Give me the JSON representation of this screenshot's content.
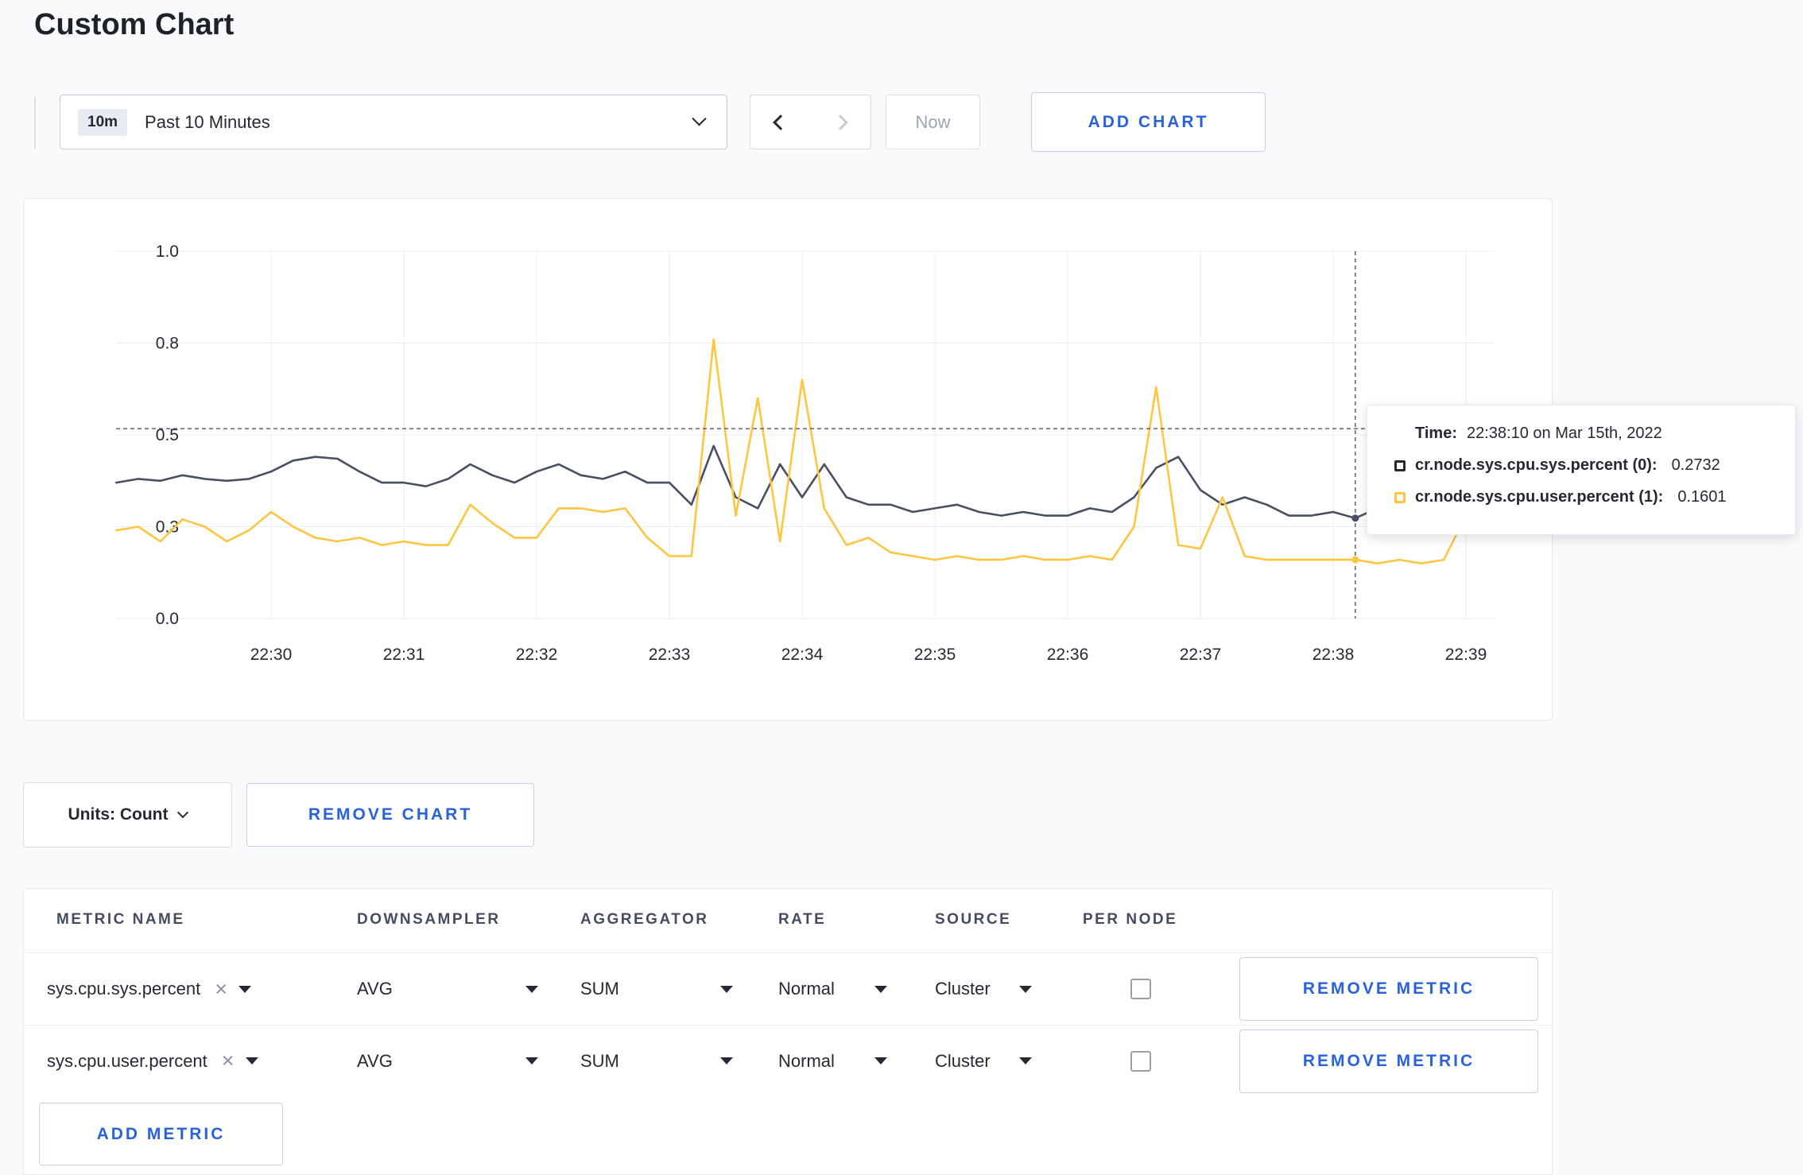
{
  "page": {
    "title": "Custom Chart"
  },
  "colors": {
    "accent": "#2962d9",
    "text_dark": "#242933",
    "muted": "#9ba3b4"
  },
  "toolbar": {
    "time_badge": "10m",
    "time_label": "Past 10 Minutes",
    "now_label": "Now",
    "add_chart_label": "ADD CHART"
  },
  "chart_data": {
    "type": "line",
    "title": "",
    "ylim": [
      0,
      1
    ],
    "y_ticks": [
      0,
      0.25,
      0.5,
      0.75,
      1
    ],
    "y_tick_labels": [
      "0.0",
      "0.3",
      "0.5",
      "0.8",
      "1.0"
    ],
    "x_tick_minutes": [
      30,
      31,
      32,
      33,
      34,
      35,
      36,
      37,
      38,
      39
    ],
    "x_ticks": [
      "22:30",
      "22:31",
      "22:32",
      "22:33",
      "22:34",
      "22:35",
      "22:36",
      "22:37",
      "22:38",
      "22:39"
    ],
    "t_start": 28.8333,
    "t_step": 0.166667,
    "grid_color": "#e9ecf2",
    "legend_position": "tooltip",
    "series": [
      {
        "name": "cr.node.sys.cpu.sys.percent",
        "color": "#475063",
        "values": [
          0.37,
          0.38,
          0.375,
          0.39,
          0.38,
          0.375,
          0.38,
          0.4,
          0.43,
          0.44,
          0.435,
          0.4,
          0.37,
          0.37,
          0.36,
          0.38,
          0.42,
          0.39,
          0.37,
          0.4,
          0.42,
          0.39,
          0.38,
          0.4,
          0.37,
          0.37,
          0.31,
          0.47,
          0.33,
          0.3,
          0.42,
          0.33,
          0.42,
          0.33,
          0.31,
          0.31,
          0.29,
          0.3,
          0.31,
          0.29,
          0.28,
          0.29,
          0.28,
          0.28,
          0.3,
          0.29,
          0.33,
          0.41,
          0.44,
          0.35,
          0.31,
          0.33,
          0.31,
          0.28,
          0.28,
          0.29,
          0.2732,
          0.3,
          0.3,
          0.31,
          0.3,
          0.3,
          0.31
        ]
      },
      {
        "name": "cr.node.sys.cpu.user.percent",
        "color": "#fdc540",
        "values": [
          0.24,
          0.25,
          0.21,
          0.27,
          0.25,
          0.21,
          0.24,
          0.29,
          0.25,
          0.22,
          0.21,
          0.22,
          0.2,
          0.21,
          0.2,
          0.2,
          0.31,
          0.26,
          0.22,
          0.22,
          0.3,
          0.3,
          0.29,
          0.3,
          0.22,
          0.17,
          0.17,
          0.76,
          0.28,
          0.6,
          0.21,
          0.65,
          0.3,
          0.2,
          0.22,
          0.18,
          0.17,
          0.16,
          0.17,
          0.16,
          0.16,
          0.17,
          0.16,
          0.16,
          0.17,
          0.16,
          0.25,
          0.63,
          0.2,
          0.19,
          0.33,
          0.17,
          0.16,
          0.16,
          0.16,
          0.16,
          0.1601,
          0.15,
          0.16,
          0.15,
          0.16,
          0.28,
          0.23
        ]
      }
    ],
    "crosshair": {
      "time_minutes": 38.1667,
      "time_label": "22:38:10",
      "hline_value": 0.517,
      "color": "#4e5565"
    }
  },
  "tooltip": {
    "time_label": "Time:",
    "time_value": "22:38:10 on Mar 15th, 2022",
    "series": [
      {
        "label": "cr.node.sys.cpu.sys.percent (0):",
        "value": "0.2732",
        "color": "#242933"
      },
      {
        "label": "cr.node.sys.cpu.user.percent (1):",
        "value": "0.1601",
        "color": "#fdc540"
      }
    ]
  },
  "units_section": {
    "units_label": "Units: Count",
    "remove_chart_label": "REMOVE CHART"
  },
  "metrics_table": {
    "headers": [
      "METRIC NAME",
      "DOWNSAMPLER",
      "AGGREGATOR",
      "RATE",
      "SOURCE",
      "PER NODE"
    ],
    "rows": [
      {
        "metric": "sys.cpu.sys.percent",
        "downsampler": "AVG",
        "aggregator": "SUM",
        "rate": "Normal",
        "source": "Cluster",
        "per_node_checked": false,
        "remove_label": "REMOVE METRIC"
      },
      {
        "metric": "sys.cpu.user.percent",
        "downsampler": "AVG",
        "aggregator": "SUM",
        "rate": "Normal",
        "source": "Cluster",
        "per_node_checked": false,
        "remove_label": "REMOVE METRIC"
      }
    ],
    "add_metric_label": "ADD METRIC"
  }
}
